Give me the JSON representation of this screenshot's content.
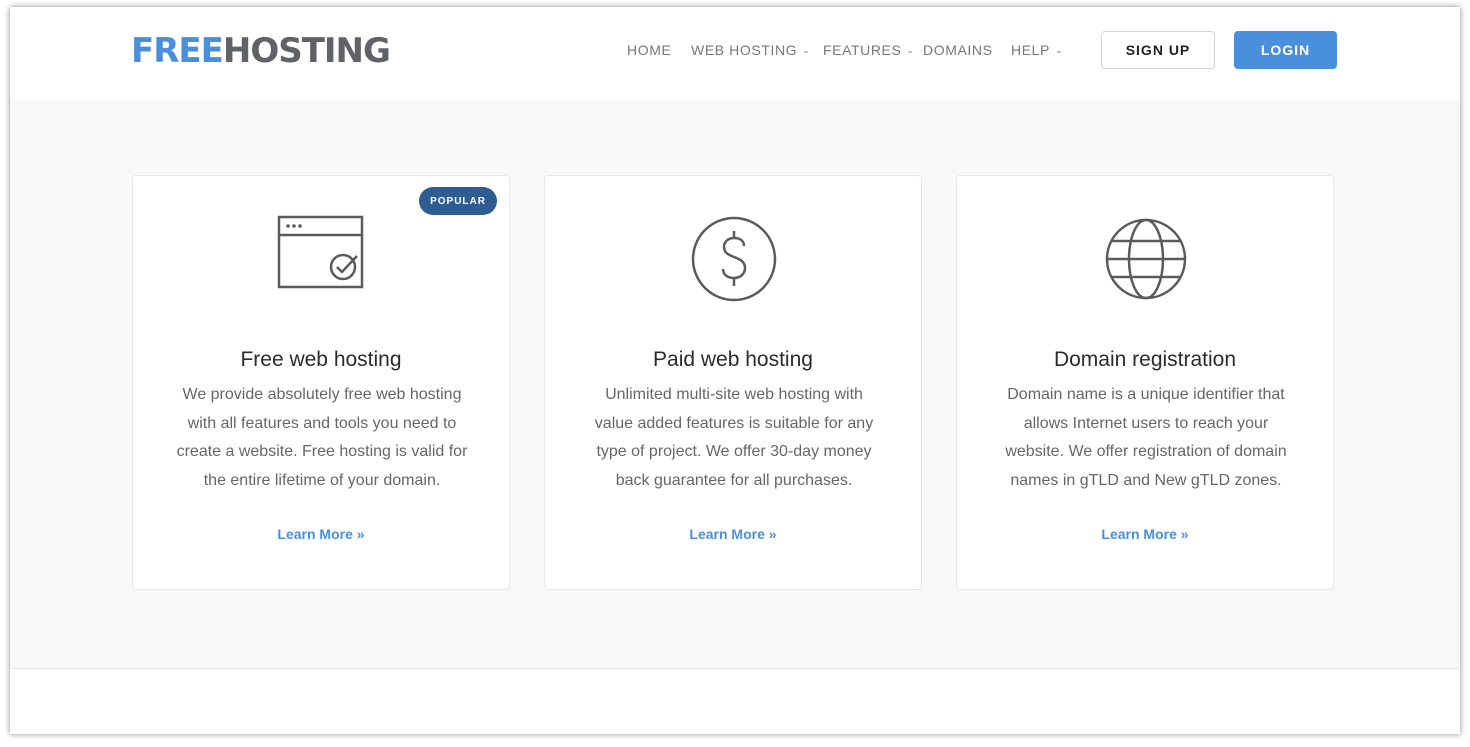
{
  "brand": {
    "part1": "FREE",
    "part2": "HOSTING"
  },
  "nav": [
    {
      "label": "HOME",
      "dropdown": false
    },
    {
      "label": "WEB HOSTING",
      "dropdown": true
    },
    {
      "label": "FEATURES",
      "dropdown": true
    },
    {
      "label": "DOMAINS",
      "dropdown": false
    },
    {
      "label": "HELP",
      "dropdown": true
    }
  ],
  "caret": "⌄",
  "buttons": {
    "signup": "SIGN UP",
    "login": "LOGIN"
  },
  "cards": [
    {
      "badge": "POPULAR",
      "icon": "browser-window-check-icon",
      "title": "Free web hosting",
      "text": "We provide absolutely free web hosting with all features and tools you need to create a website. Free hosting is valid for the entire lifetime of your domain.",
      "link": "Learn More »"
    },
    {
      "icon": "dollar-coin-icon",
      "title": "Paid web hosting",
      "text": "Unlimited multi-site web hosting with value added features is suitable for any type of project. We offer 30-day money back guarantee for all purchases.",
      "link": "Learn More »"
    },
    {
      "icon": "globe-icon",
      "title": "Domain registration",
      "text": "Domain name is a unique identifier that allows Internet users to reach your website. We offer registration of domain names in gTLD and New gTLD zones.",
      "link": "Learn More »"
    }
  ],
  "colors": {
    "accent": "#4a8fdc",
    "badge": "#2e5d92",
    "logo_dark": "#5f6266",
    "background": "#f8f8f8"
  }
}
